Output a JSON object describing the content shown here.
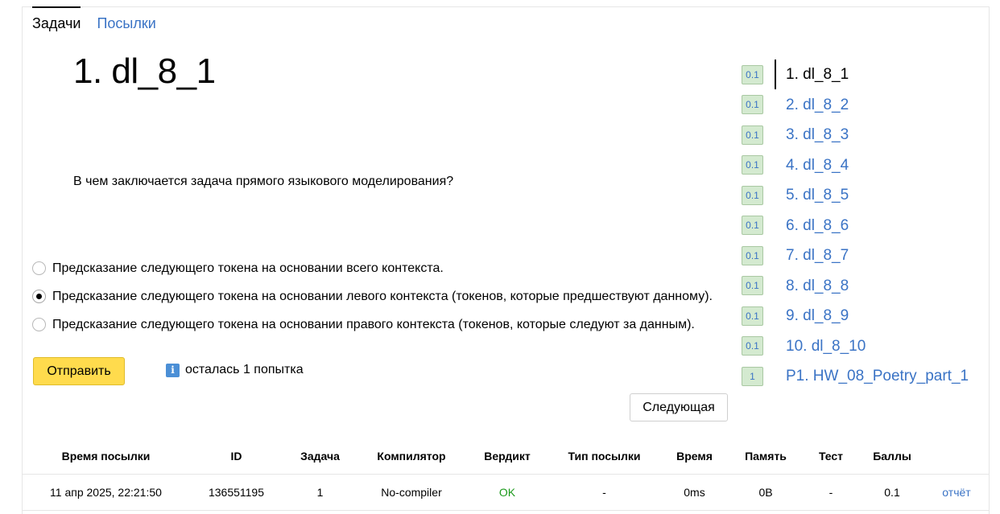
{
  "tabs": {
    "tasks": "Задачи",
    "submissions": "Посылки"
  },
  "problem": {
    "title": "1. dl_8_1",
    "question": "В чем заключается задача прямого языкового моделирования?",
    "options": [
      "Предсказание следующего токена на основании всего контекста.",
      "Предсказание следующего токена на основании левого контекста (токенов, которые предшествуют данному).",
      "Предсказание следующего токена на основании правого контекста (токенов, которые следуют за данным)."
    ],
    "selected_option_index": 1
  },
  "actions": {
    "submit_label": "Отправить",
    "attempts_text": "осталась 1 попытка",
    "info_icon_glyph": "i",
    "next_label": "Следующая"
  },
  "problem_list": [
    {
      "score": "0.1",
      "name": "1. dl_8_1",
      "active": true
    },
    {
      "score": "0.1",
      "name": "2. dl_8_2",
      "active": false
    },
    {
      "score": "0.1",
      "name": "3. dl_8_3",
      "active": false
    },
    {
      "score": "0.1",
      "name": "4. dl_8_4",
      "active": false
    },
    {
      "score": "0.1",
      "name": "5. dl_8_5",
      "active": false
    },
    {
      "score": "0.1",
      "name": "6. dl_8_6",
      "active": false
    },
    {
      "score": "0.1",
      "name": "7. dl_8_7",
      "active": false
    },
    {
      "score": "0.1",
      "name": "8. dl_8_8",
      "active": false
    },
    {
      "score": "0.1",
      "name": "9. dl_8_9",
      "active": false
    },
    {
      "score": "0.1",
      "name": "10. dl_8_10",
      "active": false
    },
    {
      "score": "1",
      "name": "P1. HW_08_Poetry_part_1",
      "active": false
    }
  ],
  "submissions_table": {
    "headers": [
      "Время посылки",
      "ID",
      "Задача",
      "Компилятор",
      "Вердикт",
      "Тип посылки",
      "Время",
      "Память",
      "Тест",
      "Баллы",
      ""
    ],
    "rows": [
      [
        "11 апр 2025, 22:21:50",
        "136551195",
        "1",
        "No-compiler",
        "OK",
        "-",
        "0ms",
        "0B",
        "-",
        "0.1",
        "отчёт"
      ]
    ]
  },
  "colors": {
    "link": "#3a73c5",
    "submit_bg": "#ffdb4d",
    "score_bg": "#d4ead0",
    "ok": "#1d9a1d",
    "info_icon": "#4b8fd6"
  }
}
